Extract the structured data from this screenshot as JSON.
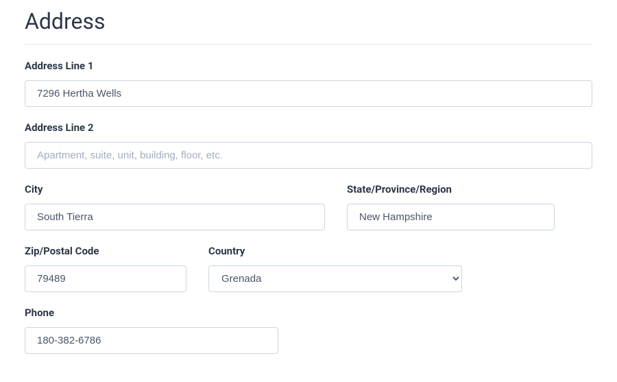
{
  "section": {
    "title": "Address"
  },
  "fields": {
    "address1": {
      "label": "Address Line 1",
      "value": "7296 Hertha Wells"
    },
    "address2": {
      "label": "Address Line 2",
      "placeholder": "Apartment, suite, unit, building, floor, etc."
    },
    "city": {
      "label": "City",
      "value": "South Tierra"
    },
    "state": {
      "label": "State/Province/Region",
      "value": "New Hampshire"
    },
    "zip": {
      "label": "Zip/Postal Code",
      "value": "79489"
    },
    "country": {
      "label": "Country",
      "selected": "Grenada"
    },
    "phone": {
      "label": "Phone",
      "value": "180-382-6786"
    }
  }
}
